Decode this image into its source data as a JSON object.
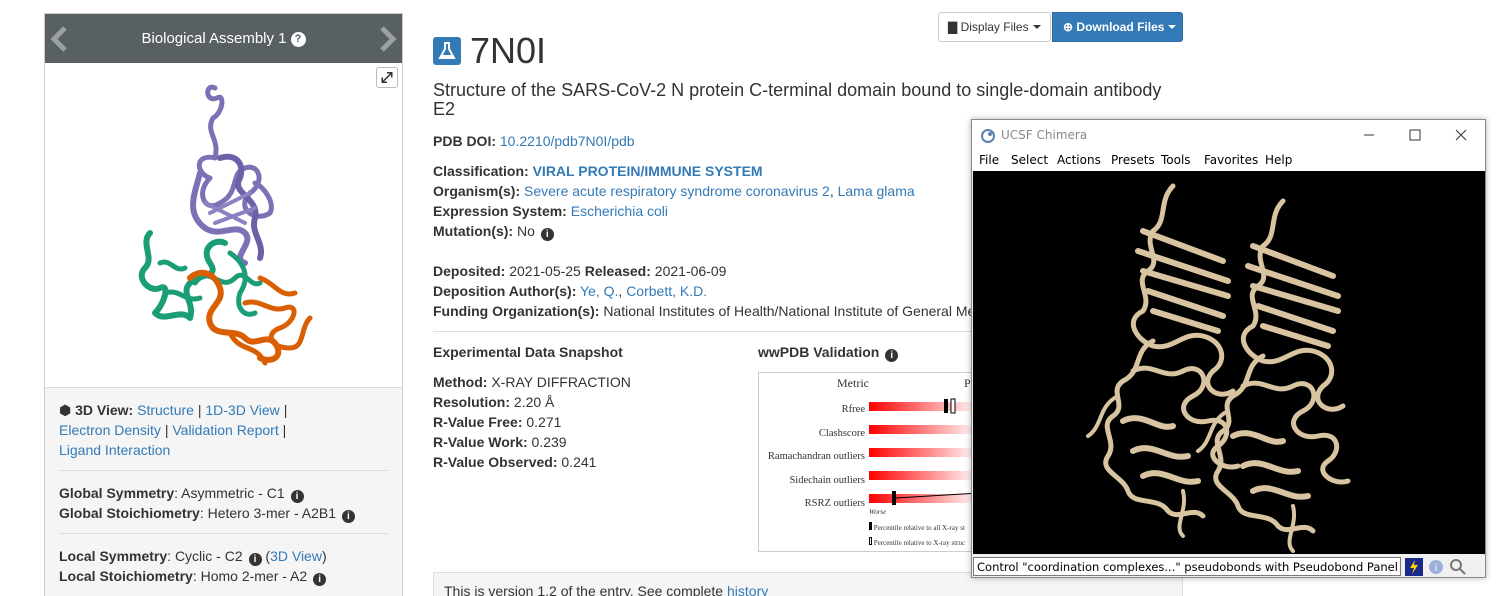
{
  "assembly": {
    "title": "Biological Assembly 1",
    "help": "?"
  },
  "entry": {
    "id": "7N0I",
    "title": "Structure of the SARS-CoV-2 N protein C-terminal domain bound to single-domain antibody E2",
    "doi_label": "PDB DOI:",
    "doi": "10.2210/pdb7N0I/pdb",
    "classification_label": "Classification:",
    "classification": "VIRAL PROTEIN/IMMUNE SYSTEM",
    "organism_label": "Organism(s):",
    "organism1": "Severe acute respiratory syndrome coronavirus 2",
    "organism2": "Lama glama",
    "expression_label": "Expression System:",
    "expression": "Escherichia coli",
    "mutation_label": "Mutation(s):",
    "mutation": "No",
    "deposited_label": "Deposited:",
    "deposited": "2021-05-25",
    "released_label": "Released:",
    "released": "2021-06-09",
    "authors_label": "Deposition Author(s):",
    "author1": "Ye, Q.",
    "author2": "Corbett, K.D.",
    "funding_label": "Funding Organization(s):",
    "funding": "National Institutes of Health/National Institute of General Me"
  },
  "toolbar": {
    "display_files": "Display Files",
    "download_files": "Download Files"
  },
  "views": {
    "label": "3D View:",
    "structure": "Structure",
    "view_1d3d": "1D-3D View",
    "electron_density": "Electron Density",
    "validation_report": "Validation Report",
    "ligand_interaction": "Ligand Interaction",
    "sep": "|"
  },
  "symmetry": {
    "global_sym_label": "Global Symmetry",
    "global_sym": ": Asymmetric - C1",
    "global_stoich_label": "Global Stoichiometry",
    "global_stoich": ": Hetero 3-mer - A2B1",
    "local_sym_label": "Local Symmetry",
    "local_sym": ": Cyclic - C2",
    "local_3d_view": "3D View",
    "local_stoich_label": "Local Stoichiometry",
    "local_stoich": ": Homo 2-mer - A2"
  },
  "experimental": {
    "heading": "Experimental Data Snapshot",
    "method_label": "Method:",
    "method": "X-RAY DIFFRACTION",
    "resolution_label": "Resolution:",
    "resolution": "2.20 Å",
    "rfree_label": "R-Value Free:",
    "rfree": "0.271",
    "rwork_label": "R-Value Work:",
    "rwork": "0.239",
    "robs_label": "R-Value Observed:",
    "robs": "0.241"
  },
  "validation": {
    "heading": "wwPDB Validation",
    "metric_header": "Metric",
    "percentile_header": "P",
    "metrics": [
      "Rfree",
      "Clashscore",
      "Ramachandran outliers",
      "Sidechain outliers",
      "RSRZ outliers"
    ],
    "worse": "Worse",
    "legend1": "Percentile relative to all X-ray st",
    "legend2": "Percentile relative to X-ray struc"
  },
  "history": {
    "text": "This is version 1.2 of the entry. See complete",
    "link": "history"
  },
  "chimera": {
    "title": "UCSF Chimera",
    "menu": [
      "File",
      "Select",
      "Actions",
      "Presets",
      "Tools",
      "Favorites",
      "Help"
    ],
    "status": "Control \"coordination complexes...\" pseudobonds with Pseudobond Panel (in"
  },
  "colors": {
    "accent": "#337ab7",
    "header": "#596064",
    "chain_a": "#7b72b5",
    "chain_b": "#1b9e77",
    "chain_c": "#d95f02",
    "chimera_ribbon": "#d8c4a0"
  }
}
